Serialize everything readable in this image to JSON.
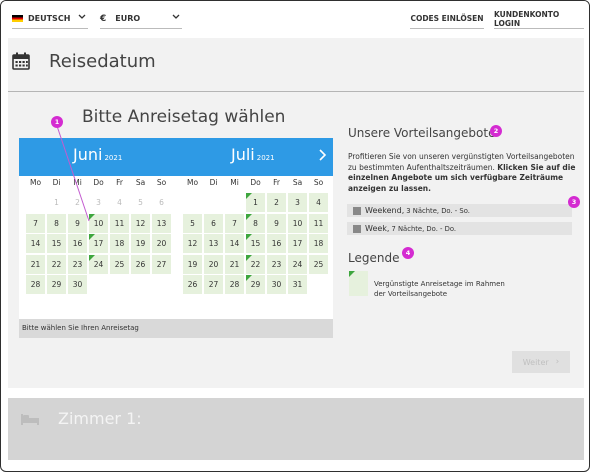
{
  "topbar": {
    "language": "DEUTSCH",
    "currency_symbol": "€",
    "currency": "EURO",
    "codes_link": "CODES EINLÖSEN",
    "login_link": "KUNDENKONTO LOGIN"
  },
  "section": {
    "icon": "calendar-icon",
    "title": "Reisedatum",
    "subtitle": "Bitte Anreisetag wählen"
  },
  "calendar": {
    "weekdays": [
      "Mo",
      "Di",
      "Mi",
      "Do",
      "Fr",
      "Sa",
      "So"
    ],
    "months": [
      {
        "name": "Juni",
        "year": "2021",
        "first_weekday": 1,
        "days": 30,
        "past_until": 6,
        "marked": [
          10,
          17,
          24
        ]
      },
      {
        "name": "Juli",
        "year": "2021",
        "first_weekday": 3,
        "days": 31,
        "past_until": 0,
        "marked": [
          1,
          8,
          15,
          22,
          29
        ]
      }
    ],
    "next_icon": "chevron-right-icon",
    "footer": "Bitte wählen Sie Ihren Anreisetag"
  },
  "offers": {
    "title": "Unsere Vorteilsangebote",
    "text": "Profitieren Sie von unseren vergünstigten Vorteilsangeboten zu bestimmten Aufenthaltszeiträumen.",
    "text_bold": "Klicken Sie auf die einzelnen Angebote um sich verfügbare Zeiträume anzeigen zu lassen.",
    "items": [
      {
        "name": "Weekend,",
        "detail": "3 Nächte, Do. - So."
      },
      {
        "name": "Week,",
        "detail": "7 Nächte, Do. - Do."
      }
    ]
  },
  "legend": {
    "title": "Legende",
    "text": "Vergünstigte Anreisetage im Rahmen der Vorteilsangebote"
  },
  "next_button": "Weiter",
  "badges": [
    "1",
    "2",
    "3",
    "4"
  ],
  "room": {
    "icon": "bed-icon",
    "title": "Zimmer 1:"
  },
  "colors": {
    "calendar_header": "#2e9ae5",
    "available_day": "#e6f1dd",
    "offer_marker": "#3ea63e",
    "badge": "#d42bd1"
  }
}
